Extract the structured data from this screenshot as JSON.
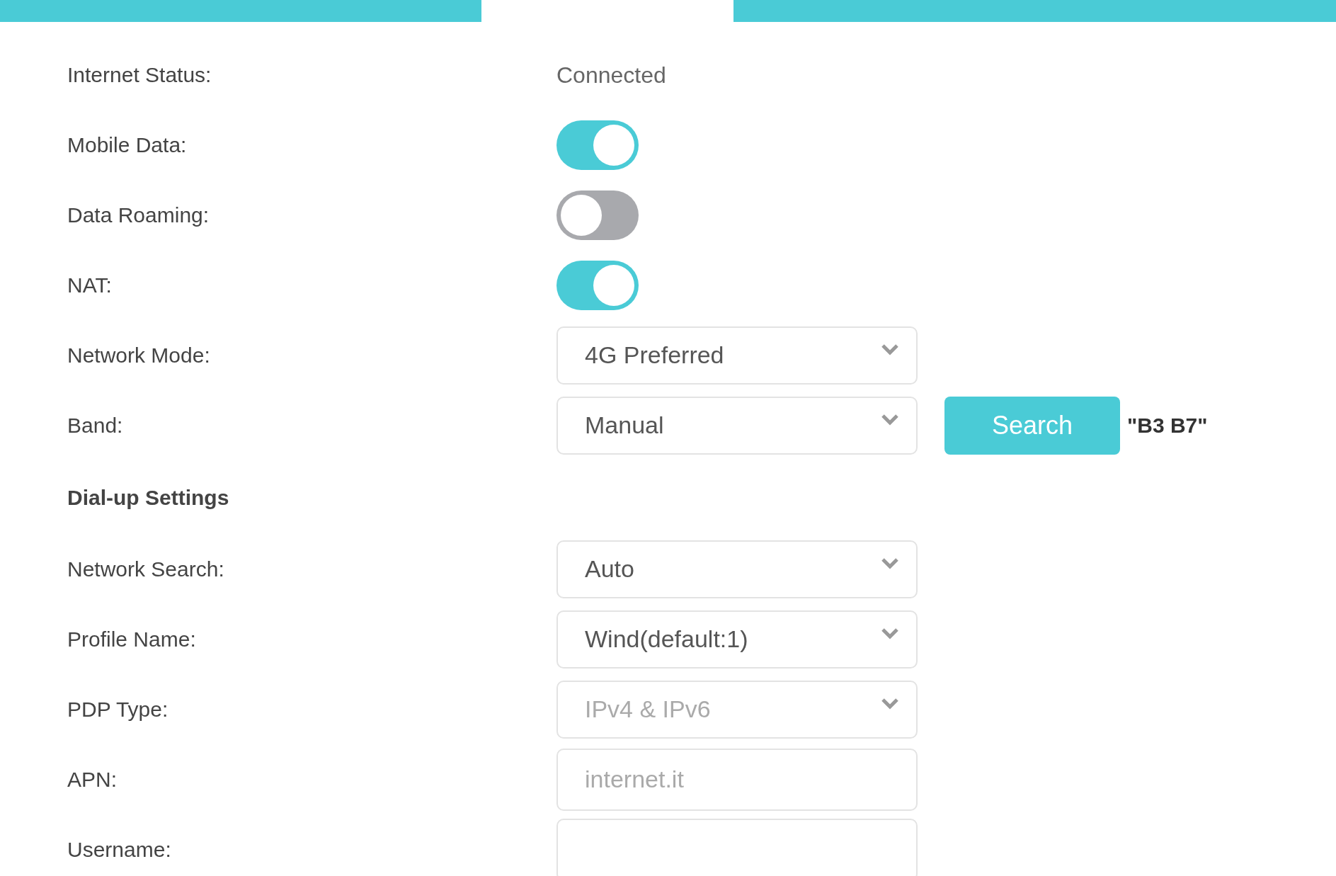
{
  "rows": [
    {
      "kind": "status",
      "label": "Internet Status:",
      "value": "Connected"
    },
    {
      "kind": "toggle",
      "label": "Mobile Data:",
      "on": true
    },
    {
      "kind": "toggle",
      "label": "Data Roaming:",
      "on": false
    },
    {
      "kind": "toggle",
      "label": "NAT:",
      "on": true
    },
    {
      "kind": "select",
      "label": "Network Mode:",
      "value": "4G Preferred",
      "disabled": false
    },
    {
      "kind": "select",
      "label": "Band:",
      "value": "Manual",
      "disabled": false,
      "button": "Search",
      "note": "\"B3 B7\""
    },
    {
      "kind": "heading",
      "label": "Dial-up Settings"
    },
    {
      "kind": "select",
      "label": "Network Search:",
      "value": "Auto",
      "disabled": false
    },
    {
      "kind": "select",
      "label": "Profile Name:",
      "value": "Wind(default:1)",
      "disabled": false
    },
    {
      "kind": "select",
      "label": "PDP Type:",
      "value": "IPv4 & IPv6",
      "disabled": true
    },
    {
      "kind": "input",
      "label": "APN:",
      "placeholder": "internet.it"
    },
    {
      "kind": "input",
      "label": "Username:"
    }
  ]
}
